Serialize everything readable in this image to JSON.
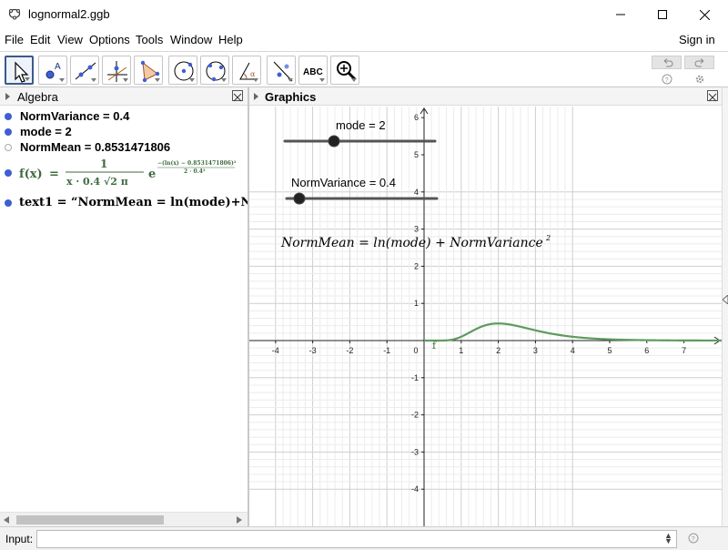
{
  "window": {
    "title": "lognormal2.ggb"
  },
  "menu": [
    "File",
    "Edit",
    "View",
    "Options",
    "Tools",
    "Window",
    "Help"
  ],
  "signin": "Sign in",
  "toolbar": {
    "text_tool_label": "ABC",
    "tools": [
      "move-tool",
      "point-tool",
      "line-tool",
      "perpendicular-line-tool",
      "polygon-tool",
      "circle-tool",
      "circle-through-points-tool",
      "angle-tool",
      "reflect-tool",
      "text-tool",
      "zoom-in-tool"
    ]
  },
  "algebra": {
    "title": "Algebra",
    "items": [
      {
        "name": "NormVariance",
        "text": "NormVariance = 0.4",
        "visible": true
      },
      {
        "name": "mode",
        "text": "mode = 2",
        "visible": true
      },
      {
        "name": "NormMean",
        "text": "NormMean = 0.8531471806",
        "visible": false
      }
    ],
    "function": {
      "lhs": "f(x)",
      "eq": "=",
      "numerator": "1",
      "denominator": "x · 0.4 √2 π",
      "exp_base": "e",
      "exponent_num": "−(ln(x) − 0.8531471806)²",
      "exponent_den": "2 · 0.4²"
    },
    "text_item": "text1  =  “NormMean = ln(mode)+N"
  },
  "graphics": {
    "title": "Graphics",
    "slider_mode_label": "mode = 2",
    "slider_variance_label": "NormVariance = 0.4",
    "slider_mode_value": 2,
    "slider_variance_value": 0.4,
    "formula_text": "NormMean = ln(mode) + NormVariance",
    "formula_exponent": "2",
    "function_label": "f",
    "x_ticks": [
      "-4",
      "-3",
      "-2",
      "-1",
      "0",
      "1",
      "2",
      "3",
      "4",
      "5",
      "6",
      "7"
    ],
    "y_ticks": [
      "6",
      "5",
      "4",
      "3",
      "2",
      "1",
      "-1",
      "-2",
      "-3",
      "-4"
    ],
    "curve_color": "#5f9a5f"
  },
  "input": {
    "label": "Input:",
    "value": ""
  }
}
